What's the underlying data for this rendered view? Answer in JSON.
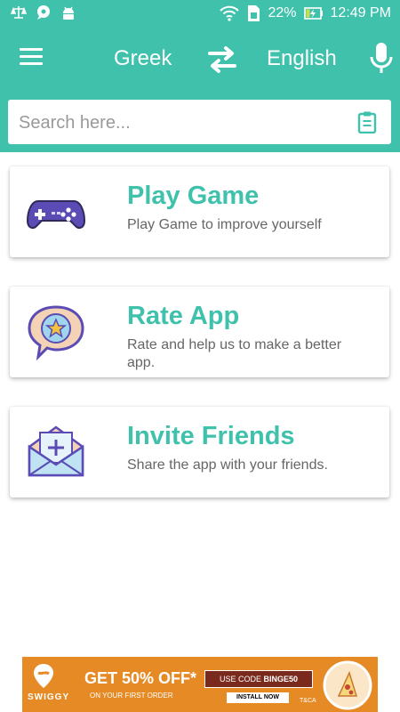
{
  "status_bar": {
    "battery": "22%",
    "time": "12:49 PM"
  },
  "toolbar": {
    "source_language": "Greek",
    "target_language": "English"
  },
  "search": {
    "placeholder": "Search here..."
  },
  "cards": [
    {
      "title": "Play Game",
      "description": "Play Game to improve yourself"
    },
    {
      "title": "Rate App",
      "description": "Rate and help us to make a better app."
    },
    {
      "title": "Invite Friends",
      "description": "Share the app with your friends."
    }
  ],
  "ad": {
    "brand": "SWIGGY",
    "headline": "GET 50% OFF*",
    "subline": "ON YOUR FIRST ORDER",
    "code_prefix": "USE CODE",
    "code": "BINGE50",
    "cta": "INSTALL NOW",
    "tc": "T&CA"
  },
  "colors": {
    "primary": "#3fc1ac",
    "ad_orange": "#e58a24",
    "icon_purple": "#5a4bb5"
  }
}
